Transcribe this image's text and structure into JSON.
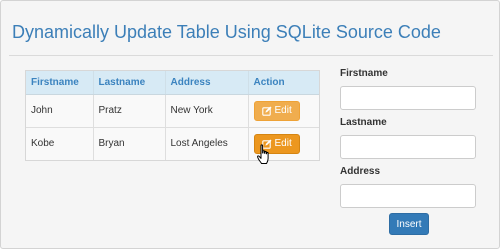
{
  "page": {
    "title": "Dynamically Update Table Using SQLite Source Code"
  },
  "table": {
    "columns": [
      "Firstname",
      "Lastname",
      "Address",
      "Action"
    ],
    "rows": [
      {
        "firstname": "John",
        "lastname": "Pratz",
        "address": "New York",
        "action": "Edit"
      },
      {
        "firstname": "Kobe",
        "lastname": "Bryan",
        "address": "Lost Angeles",
        "action": "Edit"
      }
    ]
  },
  "form": {
    "firstname_label": "Firstname",
    "lastname_label": "Lastname",
    "address_label": "Address",
    "firstname_value": "",
    "lastname_value": "",
    "address_value": "",
    "submit_label": "Insert"
  },
  "colors": {
    "title": "#3c7fb8",
    "header_bg": "#d7eaf5",
    "edit_button": "#f0ad4e",
    "insert_button": "#337ab7"
  },
  "icons": {
    "edit": "edit-icon",
    "cursor": "hand-pointer-icon"
  }
}
